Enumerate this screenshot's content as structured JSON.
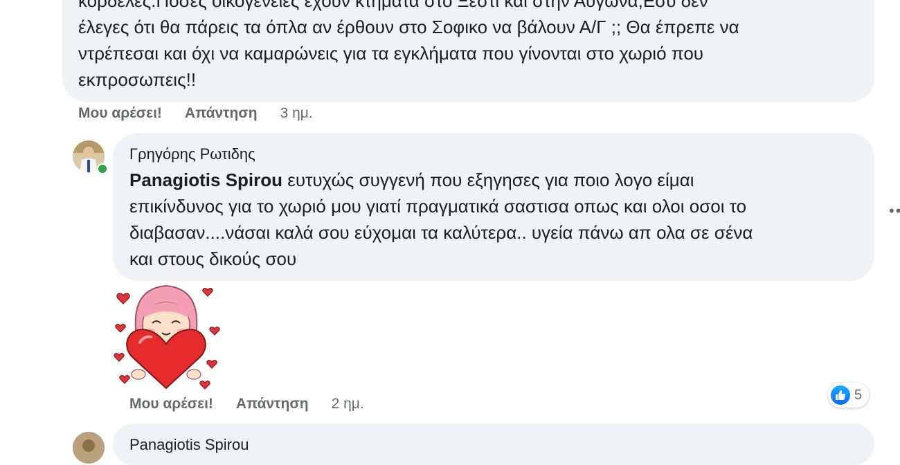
{
  "comment1": {
    "lines": [
      "κορδελες.Ποσες οικογενειες εχουν κτηματα στο Ξεστι και στην Αυγωνα;Εσύ δεν",
      "έλεγες ότι θα πάρεις τα όπλα αν έρθουν στο Σοφικο να βάλουν Α/Γ ;; Θα έπρεπε να",
      "ντρέπεσαι και όχι να καμαρώνεις για τα εγκλήματα που γίνονται στο χωριό που",
      "εκπροσωπεις!!"
    ],
    "like_label": "Μου αρέσει!",
    "reply_label": "Απάντηση",
    "time": "3 ημ."
  },
  "comment2": {
    "author": "Γρηγόρης Ρωτιδης",
    "mention": "Panagiotis Spirou",
    "lines": [
      " ευτυχώς συγγενή που εξηγησες για ποιο λογο είμαι",
      "επικίνδυνος για το χωριό μου γιατί πραγματικά σαστισα οπως και ολοι οσοι το",
      "διαβασαν....νάσαι καλά σου εύχομαι τα καλύτερα.. υγεία πάνω απ ολα σε σένα",
      "και στους δικούς σου"
    ],
    "sticker_icon": "heart-hug-girl-sticker",
    "like_label": "Μου αρέσει!",
    "reply_label": "Απάντηση",
    "time": "2 ημ.",
    "reaction_count": "5",
    "more_icon": "more-options-icon",
    "online_color": "#31a24c"
  },
  "comment3": {
    "author": "Panagiotis Spirou"
  }
}
